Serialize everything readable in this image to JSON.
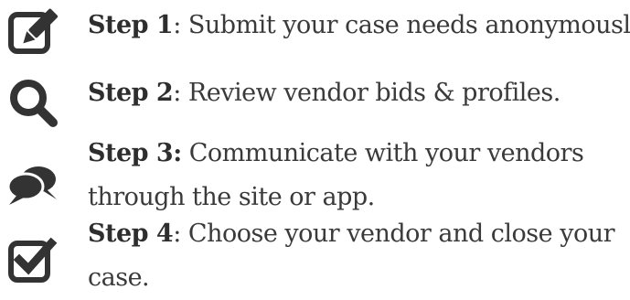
{
  "steps": [
    {
      "icon": "edit-icon",
      "label": "Step 1",
      "separator": ":",
      "lines": [
        " Submit your case needs anonymously."
      ]
    },
    {
      "icon": "search-icon",
      "label": "Step 2",
      "separator": ":",
      "lines": [
        " Review vendor bids & profiles."
      ]
    },
    {
      "icon": "chat-bubbles-icon",
      "label": "Step 3:",
      "separator": "",
      "lines": [
        " Communicate with your vendors",
        "through the site or app."
      ]
    },
    {
      "icon": "checkbox-checked-icon",
      "label": "Step 4",
      "separator": ":",
      "lines": [
        " Choose your vendor and close your",
        "case."
      ]
    }
  ],
  "colors": {
    "text": "#3a3a3a",
    "icon": "#333333"
  }
}
